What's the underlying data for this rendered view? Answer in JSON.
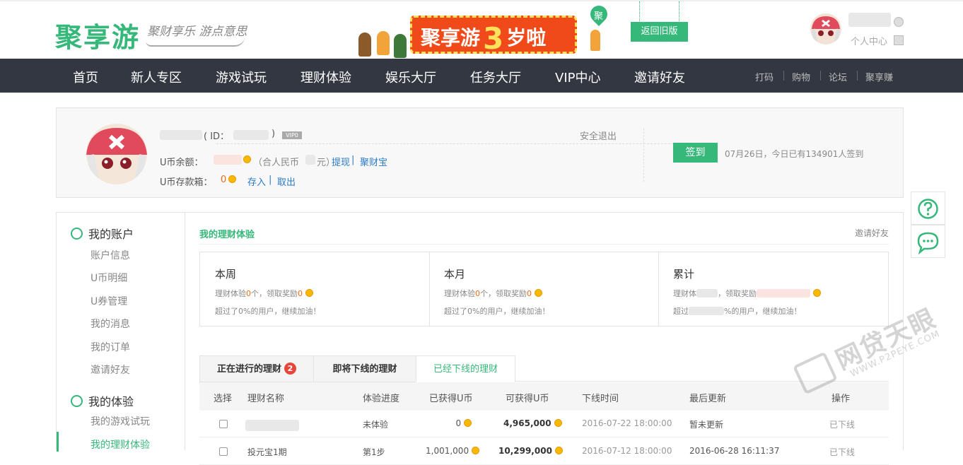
{
  "header": {
    "logo": "聚享游",
    "slogan": "聚财享乐 游点意思",
    "banner": {
      "prefix": "聚享游",
      "number": "3",
      "suffix": "岁啦",
      "pin": "聚"
    },
    "return_old": "返回旧版",
    "user_center": "个人中心"
  },
  "nav": {
    "items": [
      "首页",
      "新人专区",
      "游戏试玩",
      "理财体验",
      "娱乐大厅",
      "任务大厅",
      "VIP中心",
      "邀请好友"
    ],
    "sub_items": [
      "打码",
      "购物",
      "论坛",
      "聚享赚"
    ]
  },
  "profile": {
    "id_label": "( ID：",
    "id_close": ")",
    "vip": "VIP0",
    "logout": "安全退出",
    "balance_label": "U币余额：",
    "rmb_label": "（合人民币",
    "rmb_close": "元）",
    "withdraw": "提现",
    "jucaibao": "聚财宝",
    "box_label": "U币存款箱：",
    "box_value": "0",
    "deposit": "存入",
    "take_out": "取出",
    "signin": "签到",
    "signin_info": "07月26日，今日已有134901人签到"
  },
  "sidebar": {
    "account_head": "我的账户",
    "account_items": [
      "账户信息",
      "U币明细",
      "U券管理",
      "我的消息",
      "我的订单",
      "邀请好友"
    ],
    "exp_head": "我的体验",
    "exp_items": [
      "我的游戏试玩",
      "我的理财体验"
    ]
  },
  "main": {
    "title": "我的理财体验",
    "invite": "邀请好友",
    "stats": [
      {
        "title": "本周",
        "line1_a": "理财体验",
        "line1_n": "0",
        "line1_b": "个，领取奖励",
        "line1_v": "0",
        "line2": "超过了0%的用户，继续加油！"
      },
      {
        "title": "本月",
        "line1_a": "理财体验",
        "line1_n": "0",
        "line1_b": "个，领取奖励",
        "line1_v": "0",
        "line2": "超过了0%的用户，继续加油！"
      },
      {
        "title": "累计",
        "line1_a": "理财体",
        "line1_n": "",
        "line1_b": "，领取奖励",
        "line1_v": "",
        "line2_a": "超过",
        "line2": "%的用户，继续加油！"
      }
    ],
    "tabs": [
      {
        "label": "正在进行的理财",
        "badge": "2"
      },
      {
        "label": "即将下线的理财",
        "badge": ""
      },
      {
        "label": "已经下线的理财",
        "badge": ""
      }
    ],
    "columns": [
      "选择",
      "理财名称",
      "体验进度",
      "已获得U币",
      "可获得U币",
      "下线时间",
      "最后更新",
      "操作"
    ],
    "rows": [
      {
        "name": "",
        "progress": "未体验",
        "earned": "0",
        "available": "4,965,000",
        "offline": "2016-07-22 18:00:00",
        "updated": "暂未更新",
        "action": "已下线"
      },
      {
        "name": "投元宝1期",
        "progress": "第1步",
        "earned": "1,001,000",
        "available": "10,299,000",
        "offline": "2016-07-12 18:00:00",
        "updated": "2016-06-28 16:11:37",
        "action": "已下线"
      }
    ]
  },
  "watermark": {
    "main": "网贷天眼",
    "sub": "WWW.P2PEYE.COM"
  },
  "colors": {
    "brand_green": "#36b87a",
    "nav_bg": "#333741",
    "accent_orange": "#f06a17",
    "link_blue": "#2a79c9"
  }
}
